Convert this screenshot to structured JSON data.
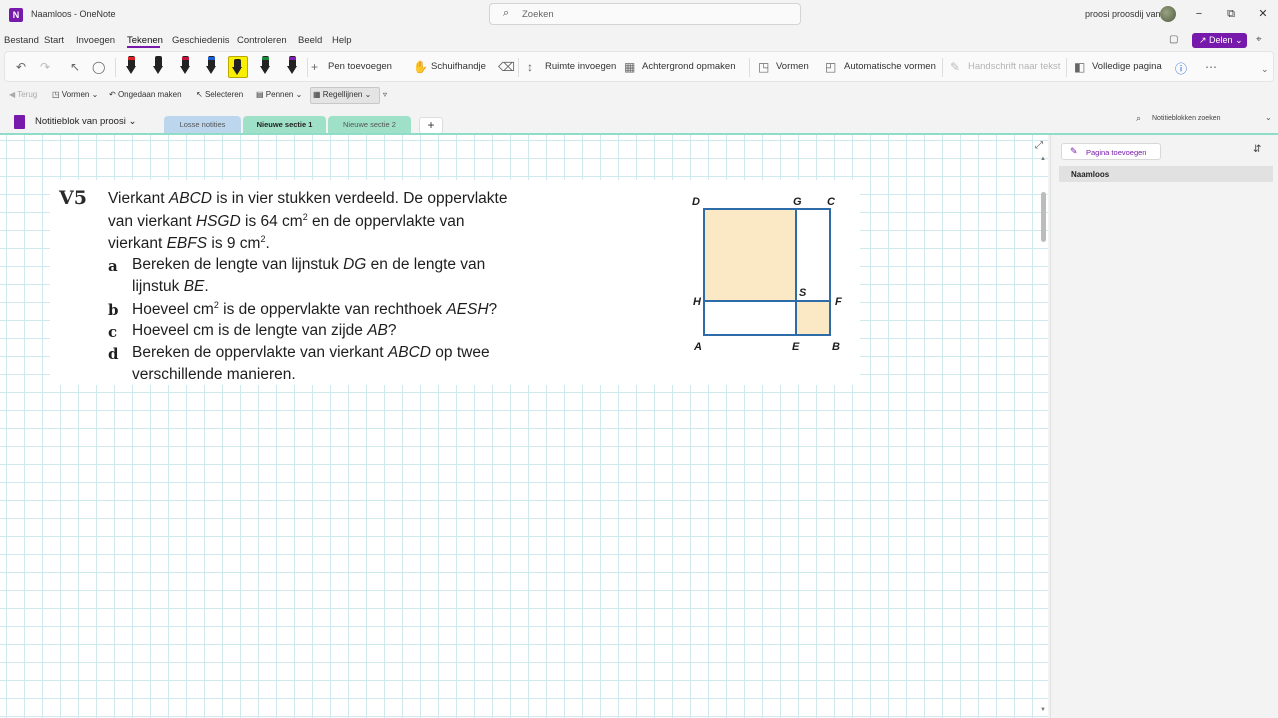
{
  "titlebar": {
    "doc_title": "Naamloos - OneNote",
    "search_placeholder": "Zoeken",
    "user_name": "proosi proosdij van",
    "minimize": "−",
    "restore": "⧉",
    "close": "✕"
  },
  "menu": {
    "items": [
      "Bestand",
      "Start",
      "Invoegen",
      "Tekenen",
      "Geschiedenis",
      "Controleren",
      "Beeld",
      "Help"
    ],
    "active": "Tekenen",
    "share": "Delen"
  },
  "ribbon": {
    "add_pen": "Pen toevoegen",
    "hand": "Schuifhandje",
    "insert_space": "Ruimte invoegen",
    "background": "Achtergrond opmaken",
    "shapes": "Vormen",
    "auto_shapes": "Automatische vormen",
    "ink_to_text": "Handschrift naar tekst",
    "full_page": "Volledige pagina",
    "pen_colors": [
      "#111111",
      "#111111",
      "#c0143c",
      "#1c5fd4",
      "#f8f000",
      "#1a8a3a",
      "#8a1ab5"
    ]
  },
  "qat": {
    "back": "Terug",
    "shapes": "Vormen",
    "undo": "Ongedaan maken",
    "select": "Selecteren",
    "pens": "Pennen",
    "rule_lines": "Regellijnen"
  },
  "sections": {
    "notebook": "Notitieblok van proosi",
    "tabs": [
      {
        "label": "Losse notities",
        "color": "#bcd6ee"
      },
      {
        "label": "Nieuwe sectie 1",
        "color": "#9fe0c8"
      },
      {
        "label": "Nieuwe sectie 2",
        "color": "#9fe0c8"
      }
    ],
    "add": "+",
    "search_notebooks": "Notitieblokken zoeken"
  },
  "exercise": {
    "number": "V5",
    "intro": [
      [
        "Vierkant ",
        {
          "i": "ABCD"
        },
        " is in vier stukken verdeeld. De oppervlakte"
      ],
      [
        "van vierkant ",
        {
          "i": "HSGD"
        },
        " is 64 cm",
        {
          "sup": "2"
        },
        " en de oppervlakte van"
      ],
      [
        "vierkant ",
        {
          "i": "EBFS"
        },
        " is 9 cm",
        {
          "sup": "2"
        },
        "."
      ]
    ],
    "questions": [
      {
        "letter": "a",
        "lines": [
          [
            "Bereken de lengte van lijnstuk ",
            {
              "i": "DG"
            },
            " en de lengte van"
          ],
          [
            "lijnstuk ",
            {
              "i": "BE"
            },
            "."
          ]
        ]
      },
      {
        "letter": "b",
        "lines": [
          [
            "Hoeveel cm",
            {
              "sup": "2"
            },
            " is de oppervlakte van rechthoek ",
            {
              "i": "AESH"
            },
            "?"
          ]
        ]
      },
      {
        "letter": "c",
        "lines": [
          [
            "Hoeveel cm is de lengte van zijde ",
            {
              "i": "AB"
            },
            "?"
          ]
        ]
      },
      {
        "letter": "d",
        "lines": [
          [
            "Bereken de oppervlakte van vierkant ",
            {
              "i": "ABCD"
            },
            " op twee"
          ],
          [
            "verschillende manieren."
          ]
        ]
      }
    ],
    "diagram_labels": {
      "D": "D",
      "G": "G",
      "C": "C",
      "H": "H",
      "S": "S",
      "F": "F",
      "A": "A",
      "E": "E",
      "B": "B"
    },
    "diagram_colors": {
      "stroke": "#2d6ca8",
      "fill": "#fbe8c4"
    }
  },
  "pages": {
    "add_page": "Pagina toevoegen",
    "items": [
      "Naamloos"
    ]
  }
}
